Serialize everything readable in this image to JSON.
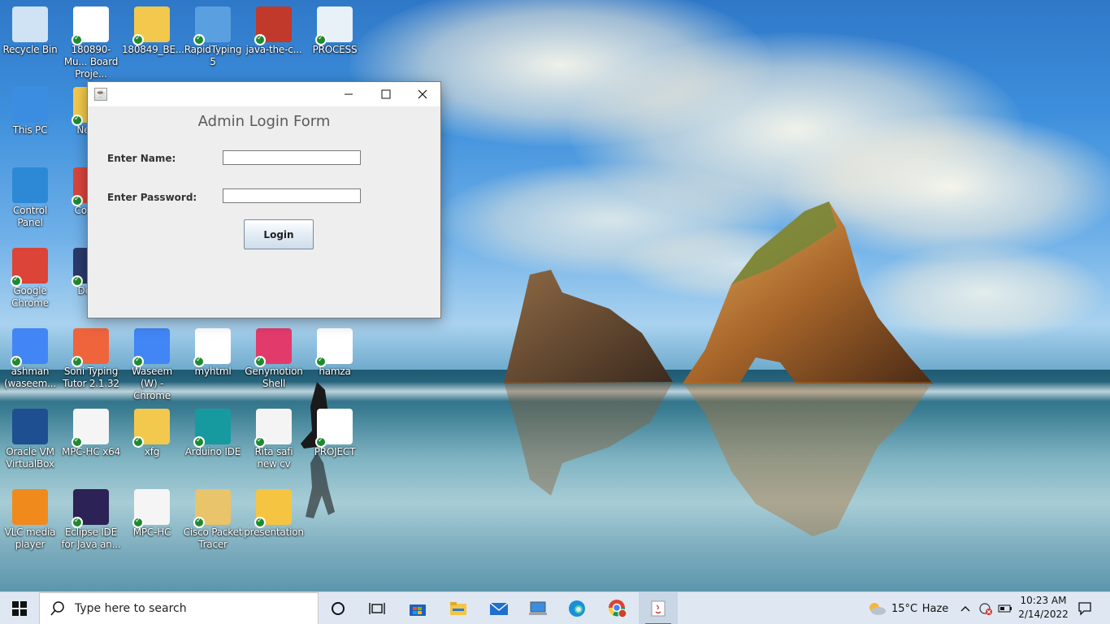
{
  "desktop": {
    "icons": [
      {
        "label": "Recycle Bin",
        "icon": "recycle-bin-icon"
      },
      {
        "label": "180890-Mu... Board Proje...",
        "icon": "document-icon"
      },
      {
        "label": "180849_BE...",
        "icon": "folder-icon"
      },
      {
        "label": "RapidTyping 5",
        "icon": "rapidtyping-icon"
      },
      {
        "label": "java-the-c...",
        "icon": "book-cover-icon"
      },
      {
        "label": "PROCESS",
        "icon": "diagram-icon"
      },
      {
        "label": "This PC",
        "icon": "computer-icon"
      },
      {
        "label": "New...",
        "icon": "folder-icon"
      },
      {
        "label": "Control Panel",
        "icon": "control-panel-icon"
      },
      {
        "label": "Code...",
        "icon": "codeblocks-icon"
      },
      {
        "label": "Google Chrome",
        "icon": "chrome-icon"
      },
      {
        "label": "Dev...",
        "icon": "devcpp-icon"
      },
      {
        "label": "ashman (waseem...",
        "icon": "chrome-profile-icon"
      },
      {
        "label": "Soni Typing Tutor 2.1.32",
        "icon": "typing-tutor-icon"
      },
      {
        "label": "Waseem (W) - Chrome",
        "icon": "chrome-profile-icon"
      },
      {
        "label": "myhtml",
        "icon": "html-file-icon"
      },
      {
        "label": "Genymotion Shell",
        "icon": "genymotion-icon"
      },
      {
        "label": "hamza",
        "icon": "word-doc-icon"
      },
      {
        "label": "Oracle VM VirtualBox",
        "icon": "virtualbox-icon"
      },
      {
        "label": "MPC-HC x64",
        "icon": "mpc-hc-icon"
      },
      {
        "label": "xfg",
        "icon": "folder-icon"
      },
      {
        "label": "Arduino IDE",
        "icon": "arduino-icon"
      },
      {
        "label": "Rita safi new cv",
        "icon": "pdf-edge-icon"
      },
      {
        "label": "PROJECT",
        "icon": "project-icon"
      },
      {
        "label": "VLC media player",
        "icon": "vlc-icon"
      },
      {
        "label": "Eclipse IDE for Java an...",
        "icon": "eclipse-icon"
      },
      {
        "label": "MPC-HC",
        "icon": "mpc-hc-icon"
      },
      {
        "label": "Cisco Packet Tracer",
        "icon": "packet-tracer-icon"
      },
      {
        "label": "presentation",
        "icon": "powerpoint-icon"
      }
    ]
  },
  "window": {
    "title": "",
    "form_title": "Admin Login Form",
    "name_label": "Enter Name:",
    "name_value": "",
    "password_label": "Enter Password:",
    "password_value": "",
    "login_label": "Login"
  },
  "taskbar": {
    "search_placeholder": "Type here to search",
    "weather_temp": "15°C",
    "weather_desc": "Haze",
    "time": "10:23 AM",
    "date": "2/14/2022"
  }
}
